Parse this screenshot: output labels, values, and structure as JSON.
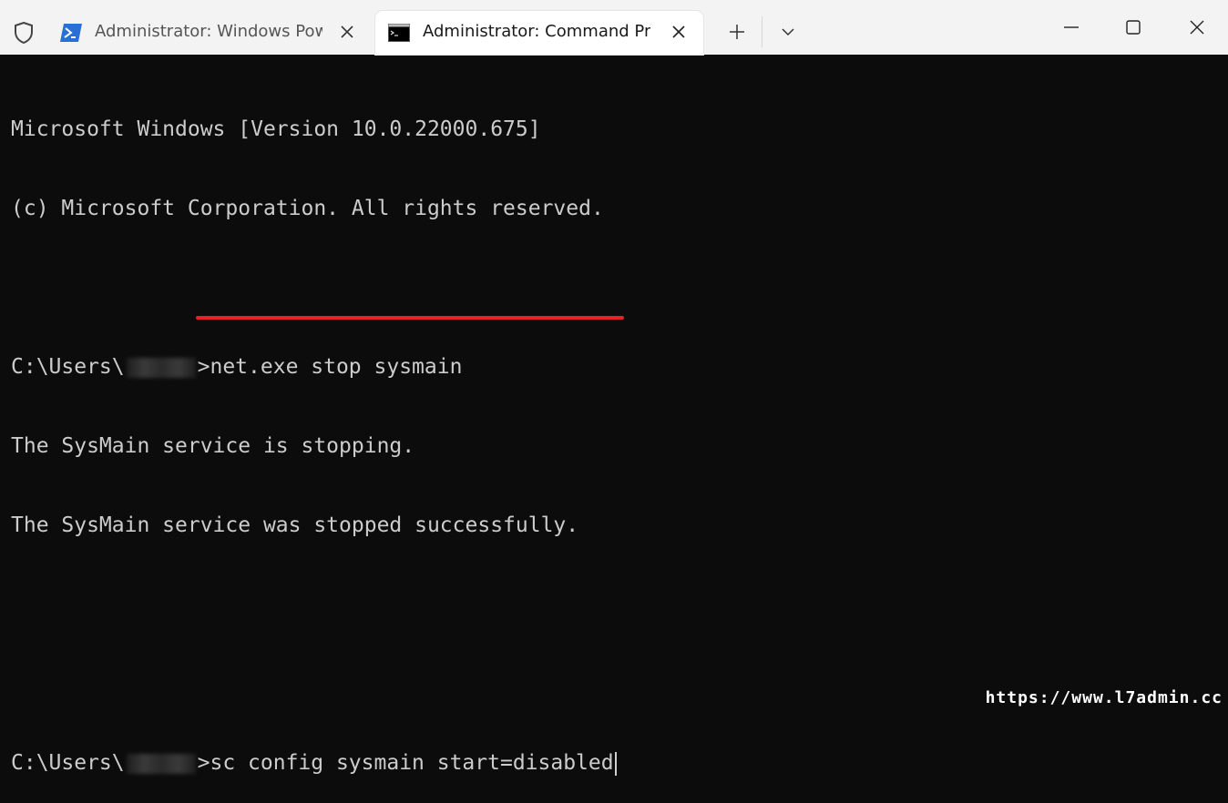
{
  "tabs": [
    {
      "title": "Administrator: Windows Powe",
      "icon": "powershell-icon"
    },
    {
      "title": "Administrator: Command Pro",
      "icon": "command-prompt-icon"
    }
  ],
  "console": {
    "line1": "Microsoft Windows [Version 10.0.22000.675]",
    "line2": "(c) Microsoft Corporation. All rights reserved.",
    "prompt_prefix": "C:\\Users\\",
    "prompt_suffix": ">",
    "cmd1": "net.exe stop sysmain",
    "out1": "The SysMain service is stopping.",
    "out2": "The SysMain service was stopped successfully.",
    "cmd2": "sc config sysmain start=disabled"
  },
  "colors": {
    "terminal_bg": "#0c0c0c",
    "terminal_text": "#cccccc",
    "highlight_underline": "#e8202a",
    "titlebar_bg": "#f3f3f3"
  },
  "watermark": "https://www.l7admin.cc"
}
